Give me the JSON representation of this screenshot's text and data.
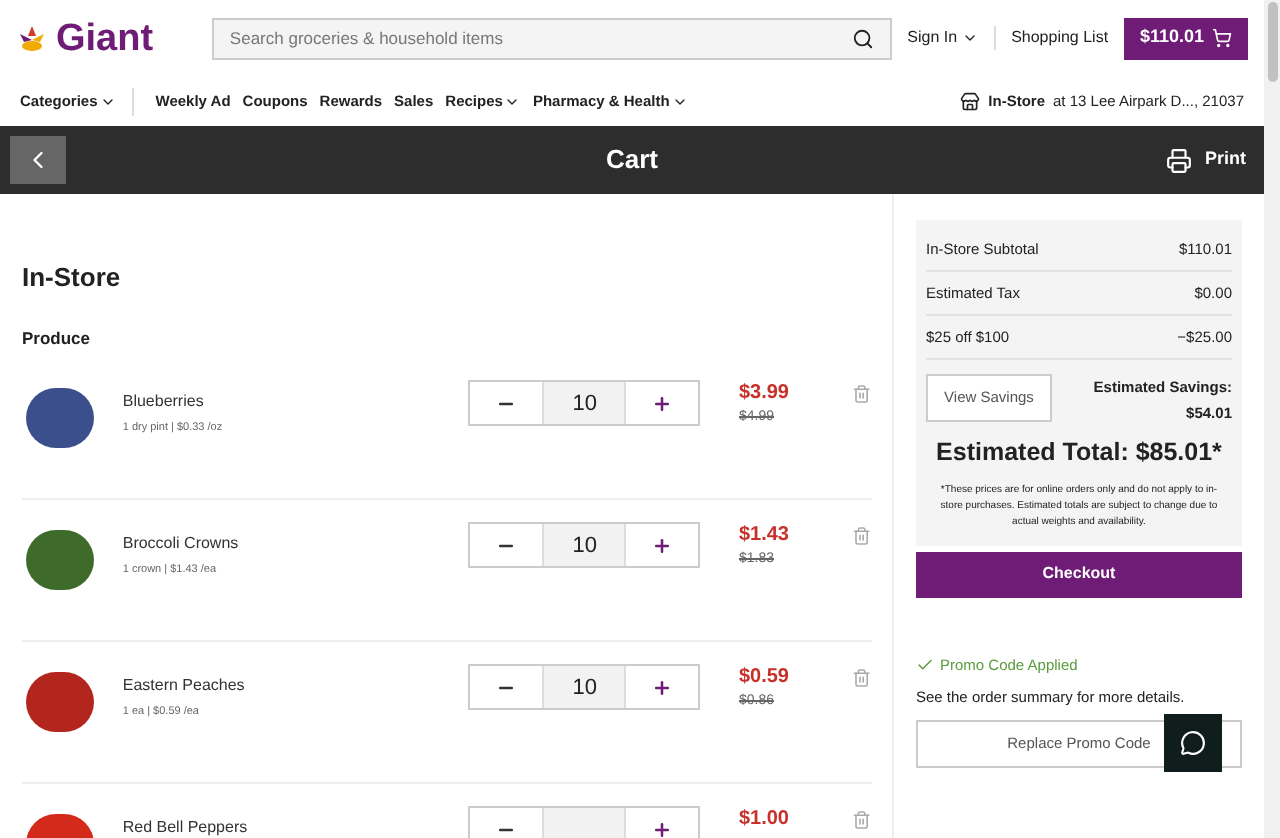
{
  "header": {
    "logo": "Giant",
    "search": {
      "placeholder": "Search groceries & household items"
    },
    "sign_in": "Sign In",
    "shopping_list": "Shopping List",
    "cart_total": "$110.01"
  },
  "nav": {
    "items": [
      {
        "label": "Categories",
        "dropdown": true
      },
      {
        "label": "Weekly Ad",
        "dropdown": false
      },
      {
        "label": "Coupons",
        "dropdown": false
      },
      {
        "label": "Rewards",
        "dropdown": false
      },
      {
        "label": "Sales",
        "dropdown": false
      },
      {
        "label": "Recipes",
        "dropdown": true
      },
      {
        "label": "Pharmacy & Health",
        "dropdown": true
      }
    ],
    "store_mode": "In-Store",
    "store_address": "at 13 Lee Airpark D..., 21037"
  },
  "title_bar": {
    "title": "Cart",
    "print": "Print"
  },
  "cart": {
    "heading": "In-Store",
    "section": "Produce",
    "items": [
      {
        "name": "Blueberries",
        "detail": "1 dry pint | $0.33 /oz",
        "quantity": "10",
        "price": "$3.99",
        "was_price": "$4.99",
        "color": "#3b4f8c"
      },
      {
        "name": "Broccoli Crowns",
        "detail": "1 crown | $1.43 /ea",
        "quantity": "10",
        "price": "$1.43",
        "was_price": "$1.83",
        "color": "#3f6b2a"
      },
      {
        "name": "Eastern Peaches",
        "detail": "1 ea | $0.59 /ea",
        "quantity": "10",
        "price": "$0.59",
        "was_price": "$0.86",
        "color": "#b3261e"
      },
      {
        "name": "Red Bell Peppers",
        "price": "$1.00",
        "color": "#d42a1c"
      }
    ]
  },
  "summary": {
    "rows": [
      {
        "label": "In-Store Subtotal",
        "value": "$110.01"
      },
      {
        "label": "Estimated Tax",
        "value": "$0.00"
      },
      {
        "label": "$25 off $100",
        "value": "−$25.00"
      }
    ],
    "view_savings": "View Savings",
    "savings_label": "Estimated Savings:",
    "savings_value": "$54.01",
    "total": "Estimated Total: $85.01*",
    "note": "*These prices are for online orders only and do not apply to in-store purchases. Estimated totals are subject to change due to actual weights and availability.",
    "checkout": "Checkout"
  },
  "promo": {
    "status": "Promo Code Applied",
    "detail": "See the order summary for more details.",
    "replace": "Replace Promo Code"
  }
}
